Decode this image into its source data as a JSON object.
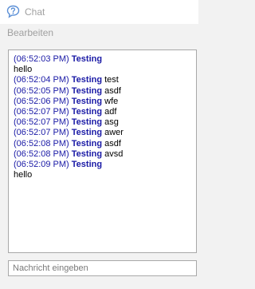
{
  "window": {
    "title": "Chat",
    "icon": "chat-bubble-icon"
  },
  "menu": {
    "items": [
      {
        "label": "Bearbeiten"
      }
    ]
  },
  "chat": {
    "lines": [
      {
        "time": "(06:52:03 PM)",
        "sender": "Testing",
        "message": ""
      },
      {
        "time": "",
        "sender": "",
        "message": "hello"
      },
      {
        "time": "(06:52:04 PM)",
        "sender": "Testing",
        "message": "test"
      },
      {
        "time": "(06:52:05 PM)",
        "sender": "Testing",
        "message": "asdf"
      },
      {
        "time": "(06:52:06 PM)",
        "sender": "Testing",
        "message": "wfe"
      },
      {
        "time": "(06:52:07 PM)",
        "sender": "Testing",
        "message": "adf"
      },
      {
        "time": "(06:52:07 PM)",
        "sender": "Testing",
        "message": "asg"
      },
      {
        "time": "(06:52:07 PM)",
        "sender": "Testing",
        "message": "awer"
      },
      {
        "time": "(06:52:08 PM)",
        "sender": "Testing",
        "message": "asdf"
      },
      {
        "time": "(06:52:08 PM)",
        "sender": "Testing",
        "message": "avsd"
      },
      {
        "time": "(06:52:09 PM)",
        "sender": "Testing",
        "message": ""
      },
      {
        "time": "",
        "sender": "",
        "message": "hello"
      }
    ]
  },
  "input": {
    "placeholder": "Nachricht eingeben",
    "value": ""
  },
  "colors": {
    "timestamp": "#1a1aa6",
    "sender": "#1a1aa6",
    "message": "#000000",
    "disabled_text": "#a0a0a0"
  }
}
